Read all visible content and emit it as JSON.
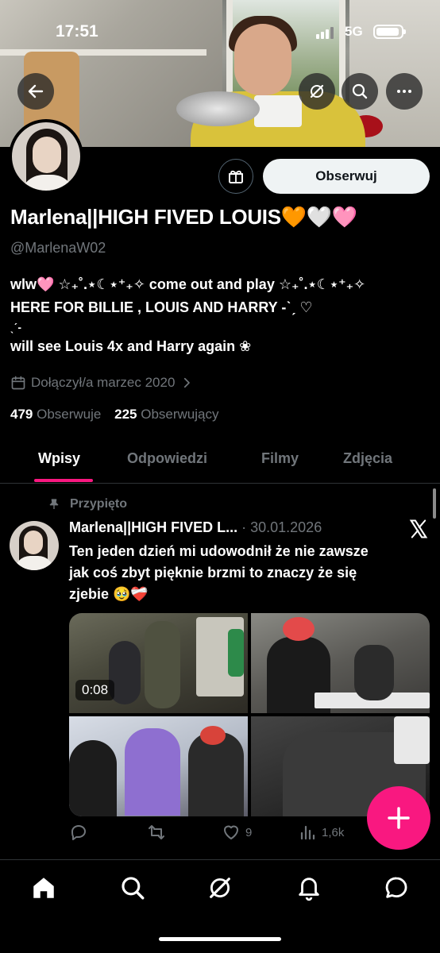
{
  "status_bar": {
    "time": "17:51",
    "network": "5G"
  },
  "profile": {
    "name": "Marlena||HIGH FIVED LOUIS🧡🤍🩷",
    "handle": "@MarlenaW02",
    "follow_label": "Obserwuj",
    "bio": [
      "wlw🩷 ☆₊˚.⋆☾⋆⁺₊✧ come out and play ☆₊˚.⋆☾⋆⁺₊✧",
      "HERE FOR BILLIE , LOUIS AND HARRY -ˋˏ ♡",
      "ˎˊ-",
      "will see Louis 4x and Harry again ❀"
    ],
    "joined": "Dołączył/a marzec 2020",
    "following_count": "479",
    "following_label": "Obserwuje",
    "followers_count": "225",
    "followers_label": "Obserwujący"
  },
  "tabs": [
    {
      "label": "Wpisy",
      "active": true
    },
    {
      "label": "Odpowiedzi",
      "active": false
    },
    {
      "label": "Filmy",
      "active": false
    },
    {
      "label": "Zdjęcia",
      "active": false
    }
  ],
  "post": {
    "pinned_label": "Przypięto",
    "author": "Marlena||HIGH FIVED L...",
    "date": "· 30.01.2026",
    "text": [
      "Ten jeden dzień mi udowodnił że nie zawsze",
      "jak coś zbyt pięknie brzmi to znaczy że się",
      "zjebie 🥹❤️‍🩹"
    ],
    "video_duration": "0:08",
    "likes": "9",
    "views": "1,6k"
  },
  "colors": {
    "accent": "#f91880",
    "muted_text": "#71767b",
    "background": "#000000",
    "follow_button_bg": "#eff3f4"
  },
  "icons": {
    "back": "arrow-left-icon",
    "hide": "eye-off-icon",
    "search": "search-icon",
    "more": "more-horizontal-icon",
    "gift": "gift-icon",
    "calendar": "calendar-icon",
    "pin": "pin-icon",
    "platform": "x-logo-icon",
    "reply": "reply-icon",
    "repost": "repost-icon",
    "like": "heart-icon",
    "views": "views-icon",
    "compose": "plus-icon",
    "nav": [
      "home-icon",
      "search-icon",
      "grok-icon",
      "bell-icon",
      "messages-icon"
    ]
  }
}
